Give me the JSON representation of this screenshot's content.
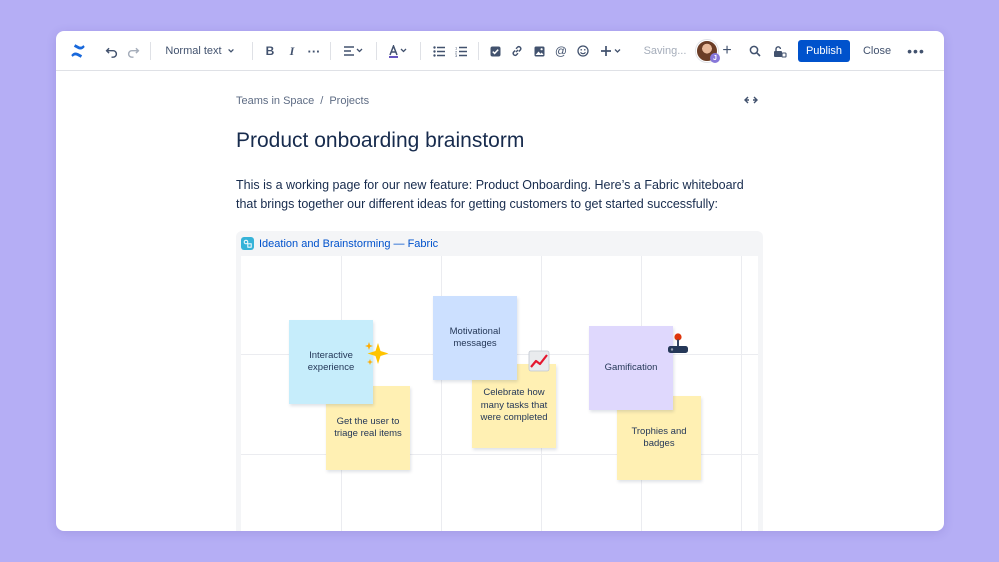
{
  "toolbar": {
    "text_style": "Normal text",
    "saving_status": "Saving...",
    "avatar_badge": "J",
    "publish_label": "Publish",
    "close_label": "Close"
  },
  "breadcrumb": {
    "items": [
      "Teams in Space",
      "Projects"
    ],
    "separator": "/"
  },
  "page": {
    "title": "Product onboarding brainstorm",
    "intro": "This is a working page for our new feature: Product Onboarding. Here’s a Fabric whiteboard that brings together our different ideas for getting customers to get started successfully:"
  },
  "whiteboard": {
    "title": "Ideation and Brainstorming — Fabric",
    "stickies": [
      {
        "text": "Interactive experience",
        "color": "#c6edfb"
      },
      {
        "text": "Get the user to triage real items",
        "color": "#fff0b3"
      },
      {
        "text": "Motivational messages",
        "color": "#cce0ff"
      },
      {
        "text": "Celebrate how many tasks that were completed",
        "color": "#fff0b3"
      },
      {
        "text": "Gamification",
        "color": "#dfd8fd"
      },
      {
        "text": "Trophies and badges",
        "color": "#fff0b3"
      }
    ],
    "stickers": [
      "sparkles-icon",
      "chart-increasing-icon",
      "joystick-icon"
    ]
  },
  "colors": {
    "background": "#b5aef5",
    "accent": "#0052cc",
    "confluence_blue": "#1868db"
  }
}
